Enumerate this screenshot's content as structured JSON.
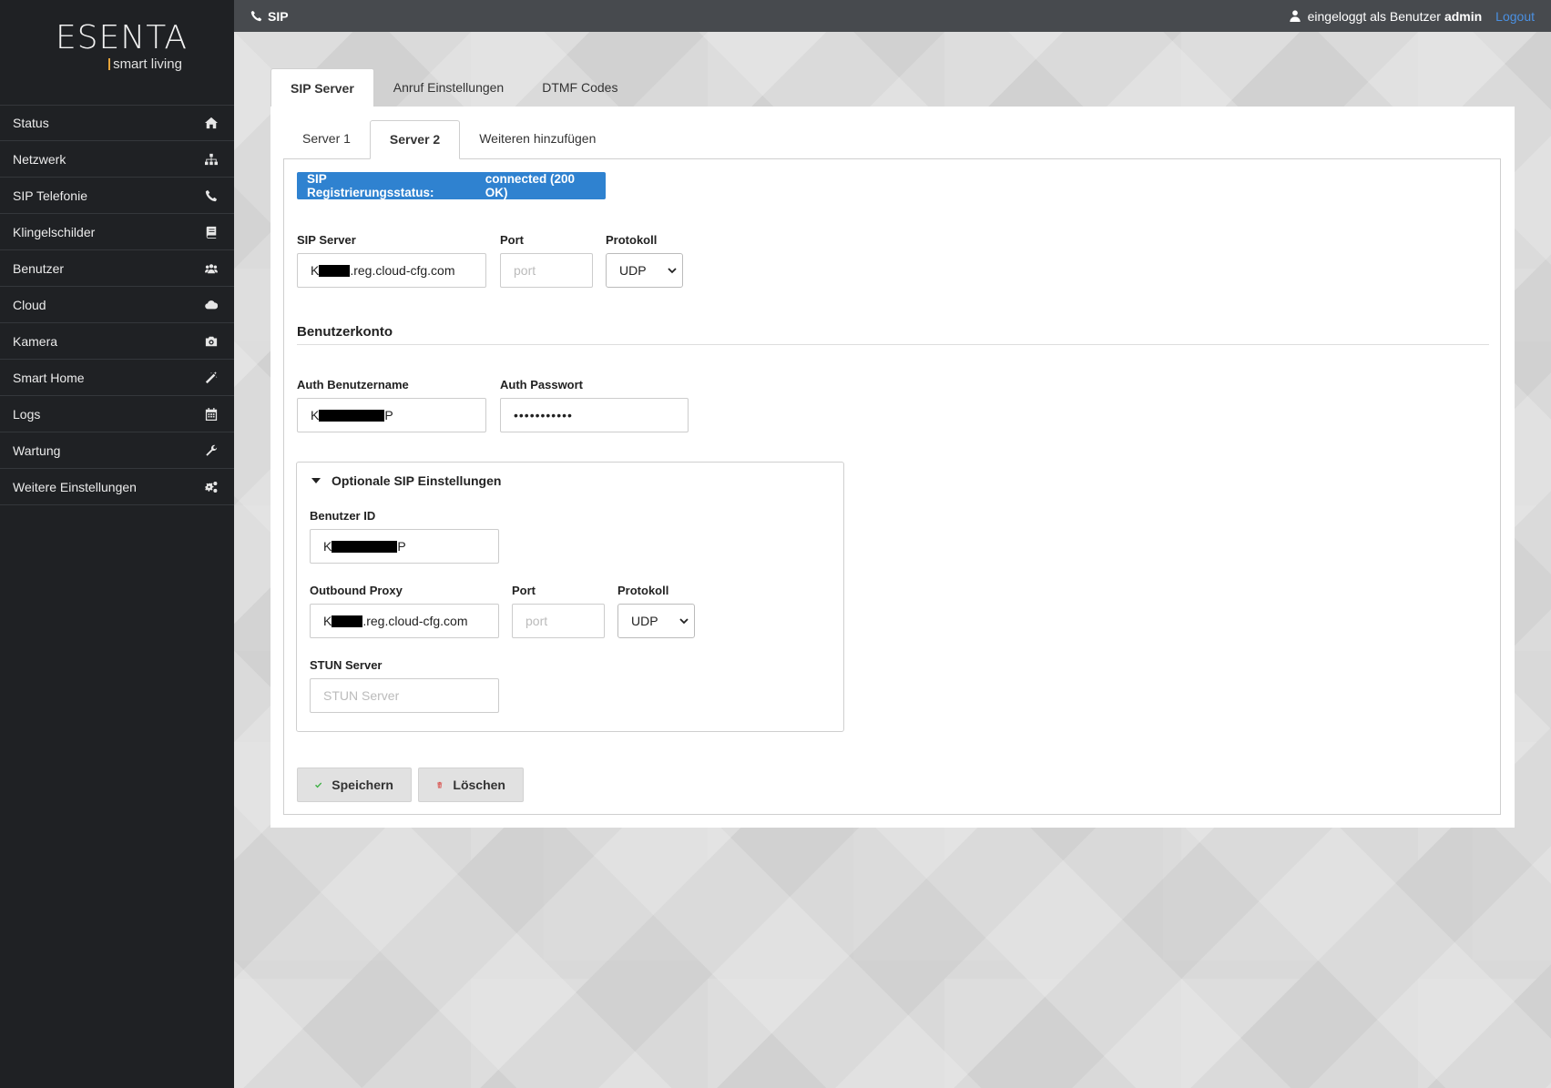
{
  "brand": {
    "name": "ESENTA",
    "tagline": "smart living"
  },
  "sidebar": {
    "items": [
      {
        "label": "Status",
        "icon": "home-icon"
      },
      {
        "label": "Netzwerk",
        "icon": "sitemap-icon"
      },
      {
        "label": "SIP Telefonie",
        "icon": "phone-icon"
      },
      {
        "label": "Klingelschilder",
        "icon": "book-icon"
      },
      {
        "label": "Benutzer",
        "icon": "users-icon"
      },
      {
        "label": "Cloud",
        "icon": "cloud-icon"
      },
      {
        "label": "Kamera",
        "icon": "camera-icon"
      },
      {
        "label": "Smart Home",
        "icon": "magic-wand-icon"
      },
      {
        "label": "Logs",
        "icon": "calendar-icon"
      },
      {
        "label": "Wartung",
        "icon": "wrench-icon"
      },
      {
        "label": "Weitere Einstellungen",
        "icon": "cogs-icon"
      }
    ]
  },
  "topbar": {
    "title": "SIP",
    "login_prefix": "eingeloggt als Benutzer",
    "username": "admin",
    "logout": "Logout"
  },
  "main_tabs": [
    "SIP Server",
    "Anruf Einstellungen",
    "DTMF Codes"
  ],
  "sub_tabs": [
    "Server 1",
    "Server 2",
    "Weiteren hinzufügen"
  ],
  "status": {
    "label": "SIP Registrierungsstatus:",
    "value": "connected (200 OK)"
  },
  "server": {
    "sip_server_label": "SIP Server",
    "sip_server_prefix": "K",
    "sip_server_suffix": ".reg.cloud-cfg.com",
    "port_label": "Port",
    "port_placeholder": "port",
    "protocol_label": "Protokoll",
    "protocol_value": "UDP"
  },
  "account": {
    "title": "Benutzerkonto",
    "auth_user_label": "Auth Benutzername",
    "auth_user_prefix": "K",
    "auth_user_suffix": "P",
    "auth_pass_label": "Auth Passwort",
    "auth_pass_value": "•••••••••••"
  },
  "optional": {
    "title": "Optionale SIP Einstellungen",
    "user_id_label": "Benutzer ID",
    "user_id_prefix": "K",
    "user_id_suffix": "P",
    "proxy_label": "Outbound Proxy",
    "proxy_prefix": "K",
    "proxy_suffix": ".reg.cloud-cfg.com",
    "port_label": "Port",
    "port_placeholder": "port",
    "protocol_label": "Protokoll",
    "protocol_value": "UDP",
    "stun_label": "STUN Server",
    "stun_placeholder": "STUN Server"
  },
  "actions": {
    "save": "Speichern",
    "delete": "Löschen"
  },
  "colors": {
    "accent": "#2f82d0",
    "logo_bar": "#e5a33a",
    "save_check": "#3cb043",
    "delete_trash": "#d9534f"
  }
}
